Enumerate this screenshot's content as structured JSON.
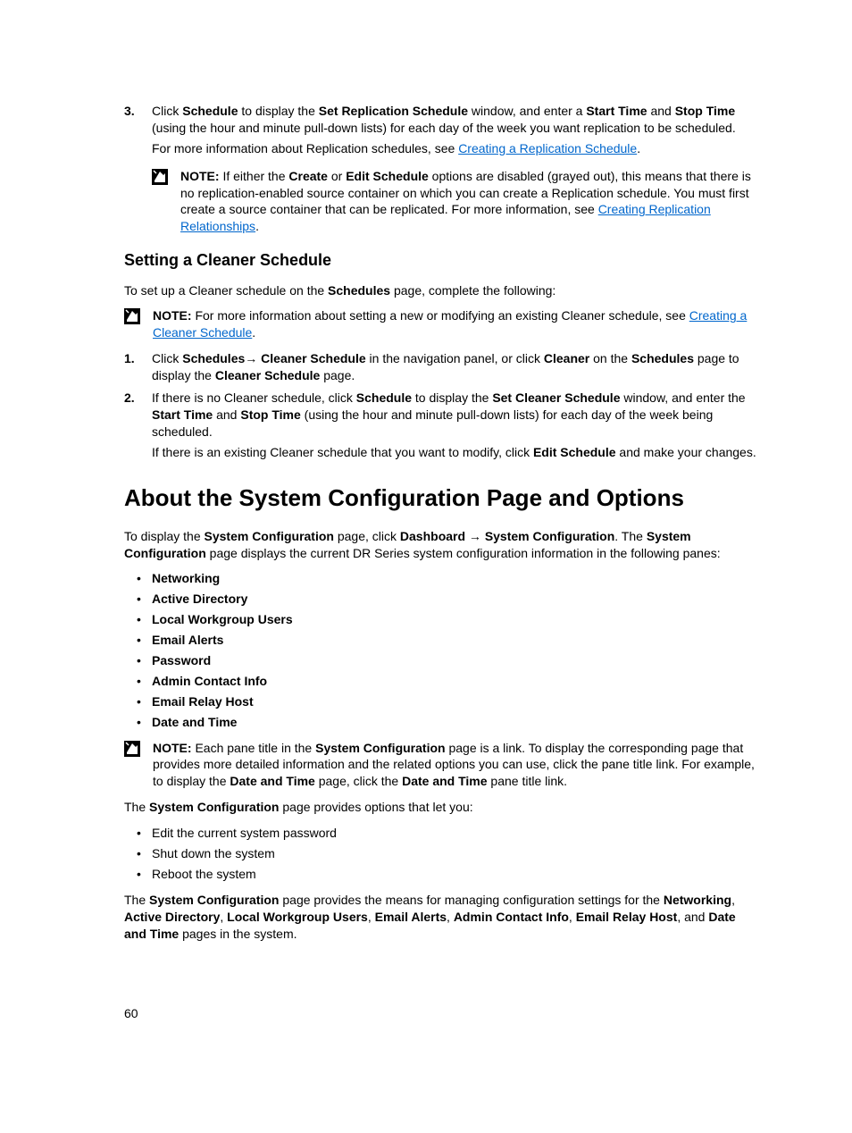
{
  "step3": {
    "marker": "3.",
    "line1_a": "Click ",
    "line1_b_bold": "Schedule",
    "line1_c": " to display the ",
    "line1_d_bold": "Set Replication Schedule",
    "line1_e": " window, and enter a ",
    "line1_f_bold": "Start Time",
    "line1_g": " and ",
    "line1_h_bold": "Stop Time",
    "line1_i": " (using the hour and minute pull-down lists) for each day of the week you want replication to be scheduled.",
    "line2_a": "For more information about Replication schedules, see ",
    "line2_link": "Creating a Replication Schedule",
    "line2_b": "."
  },
  "note1": {
    "a_bold": "NOTE:",
    "b": " If either the ",
    "c_bold": "Create",
    "d": " or ",
    "e_bold": "Edit Schedule",
    "f": " options are disabled (grayed out), this means that there is no replication-enabled source container on which you can create a Replication schedule. You must first create a source container that can be replicated. For more information, see ",
    "g_link": "Creating Replication Relationships",
    "h": "."
  },
  "subhead1": "Setting a Cleaner Schedule",
  "p1": {
    "a": "To set up a Cleaner schedule on the ",
    "b_bold": "Schedules",
    "c": " page, complete the following:"
  },
  "note2": {
    "a_bold": "NOTE:",
    "b": " For more information about setting a new or modifying an existing Cleaner schedule, see ",
    "c_link": "Creating a Cleaner Schedule",
    "d": "."
  },
  "steps2": {
    "s1": {
      "marker": "1.",
      "a": "Click ",
      "b_bold": "Schedules",
      "c": "→ ",
      "d_bold": "Cleaner Schedule",
      "e": " in the navigation panel, or click ",
      "f_bold": "Cleaner",
      "g": " on the ",
      "h_bold": "Schedules",
      "i": " page to display the ",
      "j_bold": "Cleaner Schedule",
      "k": " page."
    },
    "s2": {
      "marker": "2.",
      "a": "If there is no Cleaner schedule, click ",
      "b_bold": "Schedule",
      "c": " to display the ",
      "d_bold": "Set Cleaner Schedule",
      "e": " window, and enter the ",
      "f_bold": "Start Time",
      "g": " and ",
      "h_bold": "Stop Time",
      "i": " (using the hour and minute pull-down lists) for each day of the week being scheduled.",
      "line2_a": "If there is an existing Cleaner schedule that you want to modify, click ",
      "line2_b_bold": "Edit Schedule",
      "line2_c": " and make your changes."
    }
  },
  "head1": "About the System Configuration Page and Options",
  "p2": {
    "a": "To display the ",
    "b_bold": "System Configuration",
    "c": " page, click ",
    "d_bold": "Dashboard ",
    "e": "→ ",
    "f_bold": "System Configuration",
    "g": ". The ",
    "h_bold": "System Configuration",
    "i": " page displays the current DR Series system configuration information in the following panes:"
  },
  "panes": [
    "Networking",
    "Active Directory",
    "Local Workgroup Users",
    "Email Alerts",
    "Password",
    "Admin Contact Info",
    "Email Relay Host",
    "Date and Time"
  ],
  "note3": {
    "a_bold": "NOTE:",
    "b": " Each pane title in the ",
    "c_bold": "System Configuration",
    "d": " page is a link. To display the corresponding page that provides more detailed information and the related options you can use, click the pane title link. For example, to display the ",
    "e_bold": "Date and Time",
    "f": " page, click the ",
    "g_bold": "Date and Time",
    "h": " pane title link."
  },
  "p3": {
    "a": "The ",
    "b_bold": "System Configuration",
    "c": " page provides options that let you:"
  },
  "options": [
    "Edit the current system password",
    "Shut down the system",
    "Reboot the system"
  ],
  "p4": {
    "a": "The ",
    "b_bold": "System Configuration",
    "c": " page provides the means for managing configuration settings for the ",
    "d_bold": "Networking",
    "e": ", ",
    "f_bold": "Active Directory",
    "g": ", ",
    "h_bold": "Local Workgroup Users",
    "i": ", ",
    "j_bold": "Email Alerts",
    "k": ", ",
    "l_bold": "Admin Contact Info",
    "m": ", ",
    "n_bold": "Email Relay Host",
    "o": ", and ",
    "p_bold": "Date and Time",
    "q": " pages in the system."
  },
  "page_number": "60"
}
